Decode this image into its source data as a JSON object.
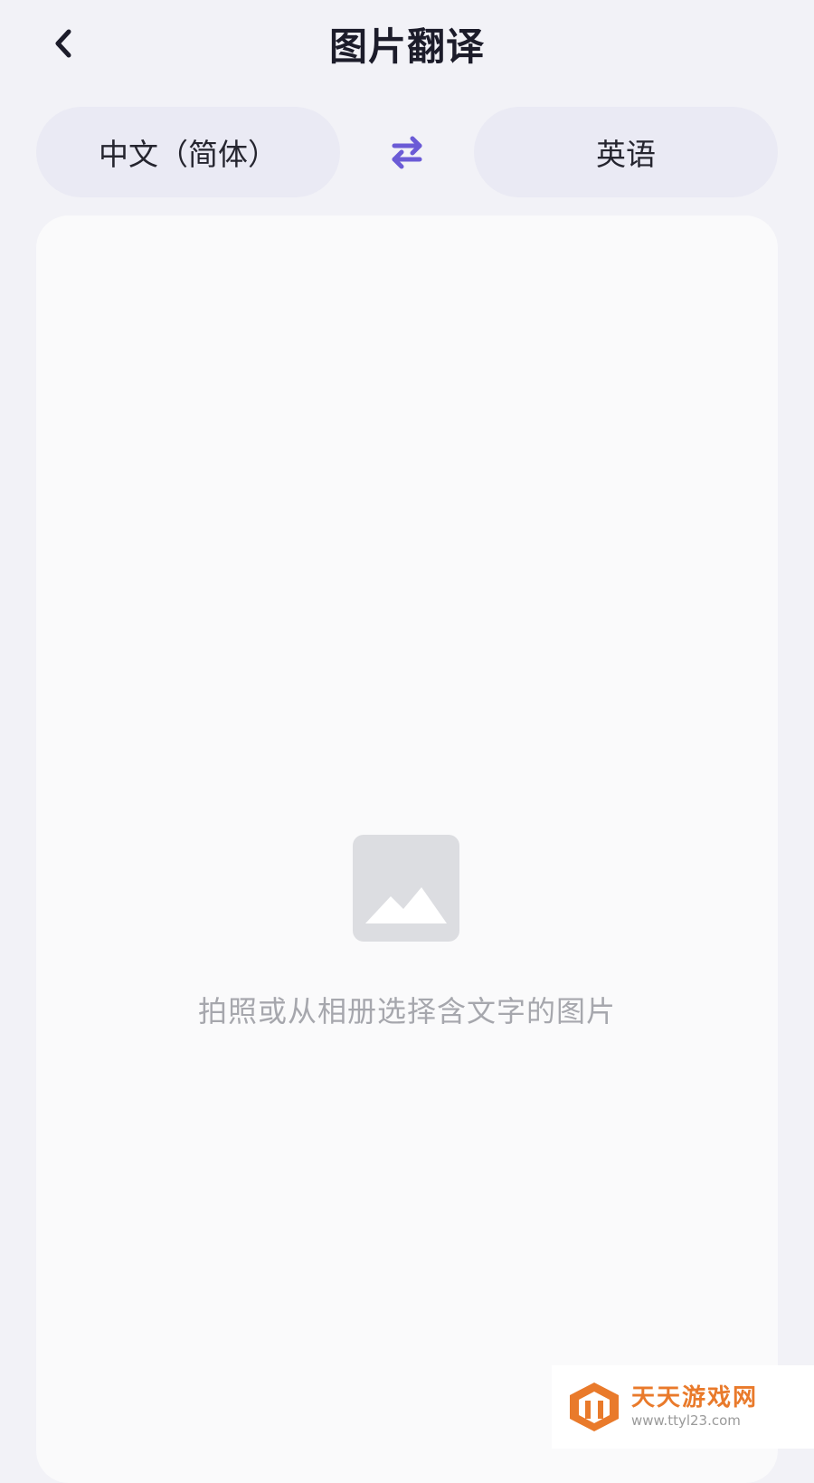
{
  "header": {
    "title": "图片翻译",
    "back_icon": "chevron-left-icon"
  },
  "languages": {
    "source": "中文（简体）",
    "target": "英语",
    "swap_icon": "swap-arrows-icon"
  },
  "main": {
    "placeholder_icon": "image-placeholder-icon",
    "hint": "拍照或从相册选择含文字的图片"
  },
  "watermark": {
    "name": "天天游戏网",
    "url": "www.ttyl23.com"
  },
  "colors": {
    "accent": "#6b5bd6",
    "background": "#f2f2f7",
    "pill": "#eaeaf4",
    "card": "#fafafb",
    "placeholder": "#dcdde1",
    "watermark": "#e97a2b"
  }
}
